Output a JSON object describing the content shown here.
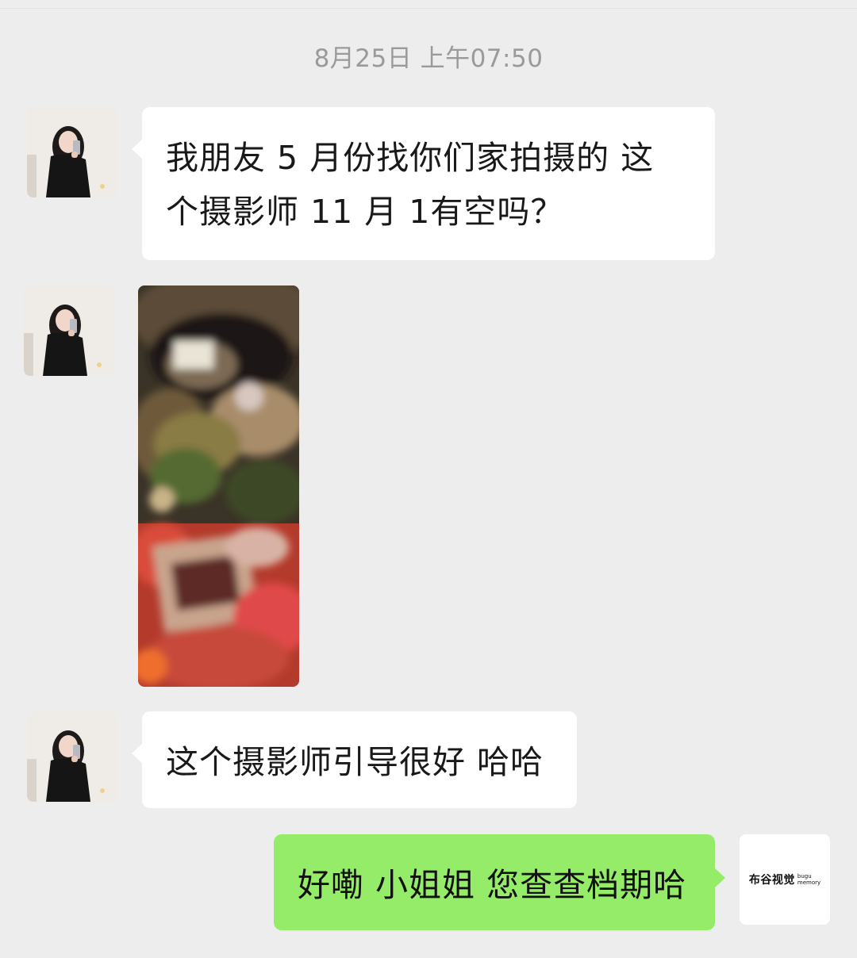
{
  "timestamp": "8月25日 上午07:50",
  "messages": [
    {
      "sender": "contact",
      "type": "text",
      "lines": [
        "我朋友 5 月份找你们家拍摄的 这",
        "个摄影师 11 月 1有空吗？"
      ]
    },
    {
      "sender": "contact",
      "type": "image",
      "content": "photo"
    },
    {
      "sender": "contact",
      "type": "text",
      "text": "这个摄影师引导很好 哈哈"
    },
    {
      "sender": "self",
      "type": "text",
      "text": "好嘞 小姐姐 您查查档期哈"
    }
  ],
  "self_avatar": {
    "brand_cn": "布谷视觉",
    "brand_en_1": "bugu",
    "brand_en_2": "memory"
  },
  "colors": {
    "background": "#ededed",
    "incoming_bubble": "#ffffff",
    "outgoing_bubble": "#95ec69",
    "timestamp": "#9a9a9a"
  },
  "icons": [
    "contact-avatar-icon",
    "brand-logo-icon"
  ]
}
